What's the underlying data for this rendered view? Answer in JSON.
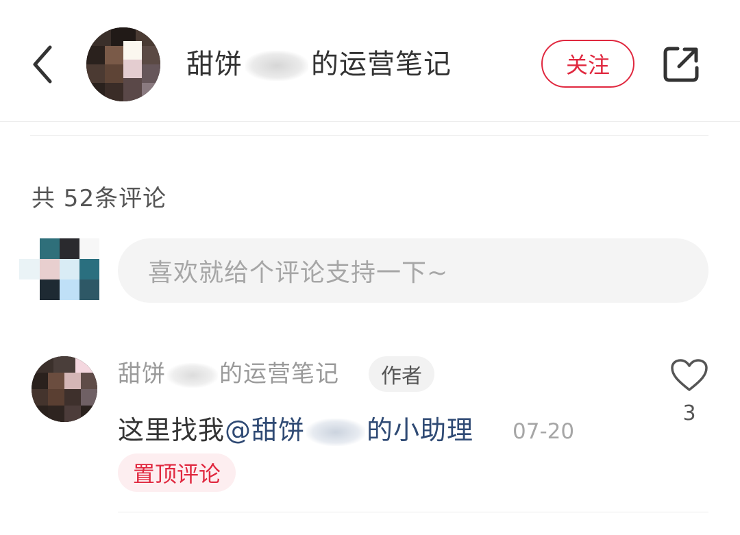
{
  "header": {
    "author_name_part1": "甜饼",
    "author_name_part2": "的运营笔记",
    "follow_label": "关注",
    "back_icon": "chevron-left-icon",
    "share_icon": "share-icon"
  },
  "comments_section": {
    "count_label": "共 52条评论",
    "input_placeholder": "喜欢就给个评论支持一下~"
  },
  "comment": {
    "name_part1": "甜饼",
    "name_part2": "的运营笔记",
    "author_badge": "作者",
    "text_prefix": "这里找我",
    "mention_part1": "@甜饼",
    "mention_part2": "的小助理",
    "date": "07-20",
    "pinned_label": "置顶评论",
    "like_count": "3",
    "like_icon": "heart-outline-icon"
  },
  "colors": {
    "accent": "#e0283f",
    "mention": "#2f4a74",
    "input_bg": "#f4f4f4",
    "pinned_bg": "#fdeef0"
  }
}
